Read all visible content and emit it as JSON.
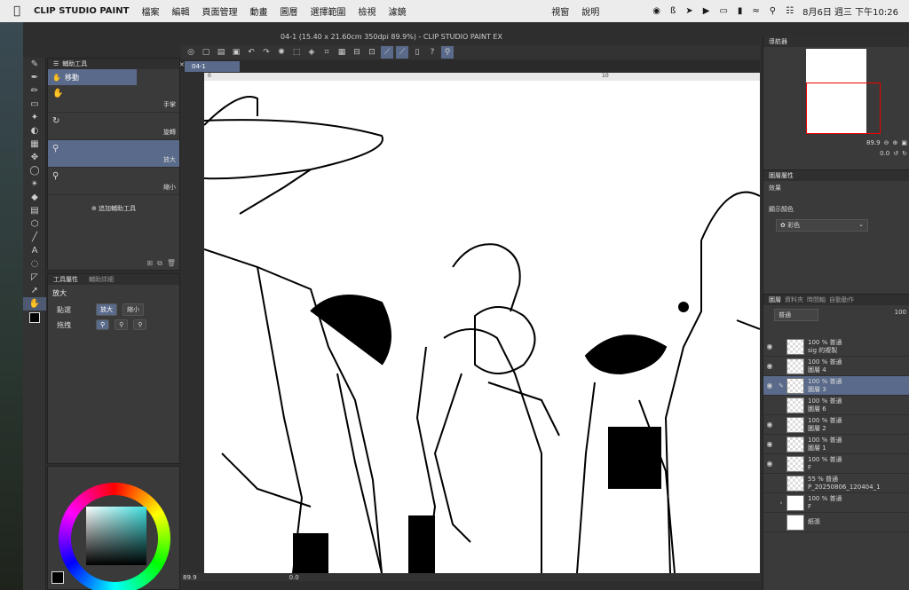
{
  "menubar": {
    "app_name": "CLIP STUDIO PAINT",
    "menus": [
      "檔案",
      "編輯",
      "頁面管理",
      "動畫",
      "圖層",
      "選擇範圍",
      "檢視",
      "濾鏡"
    ],
    "right_menus": [
      "視窗",
      "說明"
    ],
    "clock": "8月6日 週三 下午10:26"
  },
  "window": {
    "title": "04-1 (15.40 x 21.60cm 350dpi 89.9%)  - CLIP STUDIO PAINT EX",
    "tab": "04-1"
  },
  "subtool": {
    "header": "輔助工具",
    "current": "移動",
    "items": [
      {
        "label": "手掌",
        "icon": "hand-icon"
      },
      {
        "label": "旋轉",
        "icon": "rotate-icon"
      },
      {
        "label": "放大",
        "icon": "zoom-icon"
      },
      {
        "label": "縮小",
        "icon": "zoom-out-icon"
      }
    ],
    "add": "追加輔助工具"
  },
  "toolprop": {
    "tab1": "工具屬性",
    "tab2": "輔助詳細",
    "title": "放大",
    "click_label": "點選",
    "click_opt1": "放大",
    "click_opt2": "縮小",
    "drag_label": "拖拽"
  },
  "ruler": {
    "t0": "0",
    "t10": "10"
  },
  "status": {
    "zoom": "89.9",
    "angle": "0.0"
  },
  "navigator": {
    "tab": "導航器",
    "zoom": "89.9",
    "rotate": "0.0"
  },
  "layerprop": {
    "tab": "圖層屬性",
    "effect": "效果",
    "display_color": "顯示顏色",
    "color_value": "彩色"
  },
  "layers": {
    "tabs": [
      "圖層",
      "資料夾",
      "時間軸",
      "自動動作"
    ],
    "blend": "普通",
    "opacity": "100",
    "items": [
      {
        "meta": "100 % 普通",
        "name": "sig 的複製",
        "selected": false,
        "white": false
      },
      {
        "meta": "100 % 普通",
        "name": "圖層 4",
        "selected": false,
        "white": false
      },
      {
        "meta": "100 % 普通",
        "name": "圖層 3",
        "selected": true,
        "white": false
      },
      {
        "meta": "100 % 普通",
        "name": "圖層 6",
        "selected": false,
        "white": false
      },
      {
        "meta": "100 % 普通",
        "name": "圖層 2",
        "selected": false,
        "white": false
      },
      {
        "meta": "100 % 普通",
        "name": "圖層 1",
        "selected": false,
        "white": false
      },
      {
        "meta": "100 % 普通",
        "name": "F",
        "selected": false,
        "white": false
      },
      {
        "meta": "55 % 普通",
        "name": "P_20250806_120404_1",
        "selected": false,
        "white": false
      },
      {
        "meta": "100 % 普通",
        "name": "F",
        "selected": false,
        "white": false
      },
      {
        "meta": "",
        "name": "紙張",
        "selected": false,
        "white": true
      }
    ]
  },
  "colors": {
    "accent": "#5a6a8a",
    "foreground": "#000000"
  }
}
